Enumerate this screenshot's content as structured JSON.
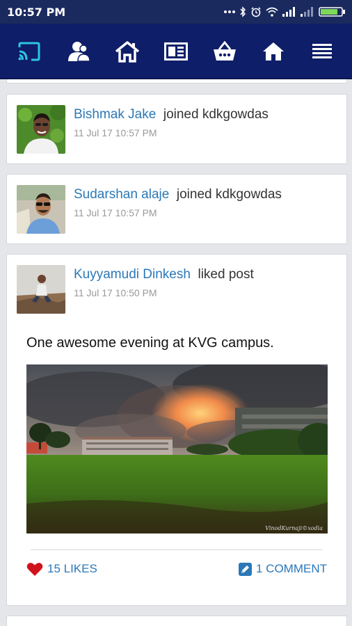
{
  "status_bar": {
    "time": "10:57 PM"
  },
  "nav": {
    "items": [
      {
        "icon": "cast-icon"
      },
      {
        "icon": "users-icon"
      },
      {
        "icon": "home-outline-icon"
      },
      {
        "icon": "newspaper-icon"
      },
      {
        "icon": "basket-icon"
      },
      {
        "icon": "home-icon"
      },
      {
        "icon": "menu-icon"
      }
    ],
    "active_color": "#2ec4e6",
    "background_color": "#0e1e68"
  },
  "feed": {
    "activities": [
      {
        "user": "Bishmak Jake",
        "action": "joined kdkgowdas",
        "timestamp": "11 Jul 17 10:57 PM"
      },
      {
        "user": "Sudarshan alaje",
        "action": "joined kdkgowdas",
        "timestamp": "11 Jul 17 10:57 PM"
      },
      {
        "user": "Kuyyamudi Dinkesh",
        "action": "liked post",
        "timestamp": "11 Jul 17 10:50 PM",
        "post_text": "One awesome evening at KVG campus.",
        "photo_watermark": "VinodKurnaji©xodia",
        "likes_label": "15 LIKES",
        "comments_label": "1 COMMENT"
      }
    ]
  },
  "colors": {
    "link": "#2b78b8",
    "like_heart": "#d0121c"
  }
}
